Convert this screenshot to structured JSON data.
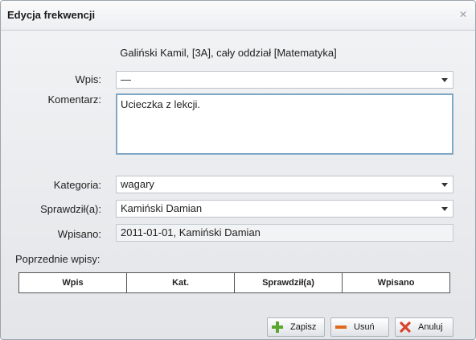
{
  "dialog": {
    "title": "Edycja frekwencji",
    "headline": "Galiński Kamil, [3A], cały oddział [Matematyka]"
  },
  "form": {
    "wpis_label": "Wpis:",
    "wpis_value": "—",
    "komentarz_label": "Komentarz:",
    "komentarz_value": "Ucieczka z lekcji.",
    "kategoria_label": "Kategoria:",
    "kategoria_value": "wagary",
    "sprawdzil_label": "Sprawdził(a):",
    "sprawdzil_value": "Kamiński Damian",
    "wpisano_label": "Wpisano:",
    "wpisano_value": "2011-01-01, Kamiński Damian"
  },
  "previous": {
    "label": "Poprzednie wpisy:",
    "columns": [
      "Wpis",
      "Kat.",
      "Sprawdził(a)",
      "Wpisano"
    ]
  },
  "buttons": {
    "save": "Zapisz",
    "delete": "Usuń",
    "cancel": "Anuluj"
  },
  "icons": {
    "close": "close-icon",
    "save": "plus-icon",
    "delete": "minus-icon",
    "cancel": "x-icon"
  },
  "colors": {
    "save_icon": "#5aa72e",
    "delete_icon": "#e06a1d",
    "cancel_icon": "#d8452c"
  }
}
